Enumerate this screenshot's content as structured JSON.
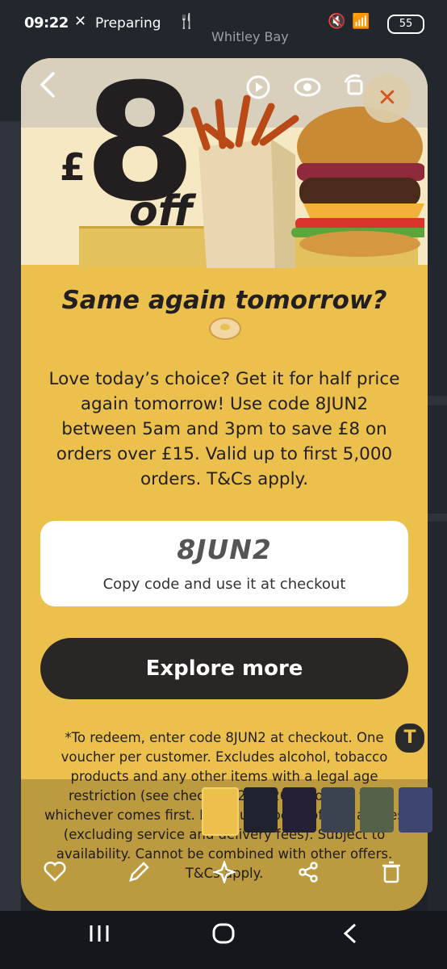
{
  "status_bar": {
    "time": "09:22",
    "notification": "Preparing",
    "battery": "55"
  },
  "background": {
    "place_name": "Whitley Bay"
  },
  "modal": {
    "hero": {
      "currency": "£",
      "amount": "8",
      "off_label": "off"
    },
    "headline": "Same again tomorrow?",
    "body": "Love today’s choice? Get it for half price again tomorrow! Use code 8JUN2 between 5am and 3pm to save £8 on orders over £15. Valid up to first 5,000 orders. T&Cs apply.",
    "code_card": {
      "code": "8JUN2",
      "hint": "Copy code and use it at checkout"
    },
    "explore_button": "Explore more",
    "terms": "*To redeem, enter code 8JUN2 at checkout. One voucher per customer. Excludes alcohol, tobacco products and any other items with a legal age restriction (see check... 02.06.26 or for the fi... whichever comes first. Minimum spend of £15 applies (excluding service and delivery fees). Subject to availability. Cannot be combined with other offers. T&Cs apply."
  },
  "icons": {
    "back": "chevron-left-icon",
    "play": "play-icon",
    "view": "eye-icon",
    "rotate": "rotate-icon",
    "close": "close-icon",
    "text_tool": "text-icon",
    "favorite": "heart-icon",
    "edit": "pencil-icon",
    "ai": "sparkle-icon",
    "share": "share-icon",
    "delete": "trash-icon"
  },
  "text_tool_glyph": "T",
  "nav": {
    "recents": "|||",
    "home": "O",
    "back": "<"
  },
  "colors": {
    "modal_bg": "#ebc04d",
    "button_dark": "#292625",
    "close_icon": "#d5561f"
  }
}
